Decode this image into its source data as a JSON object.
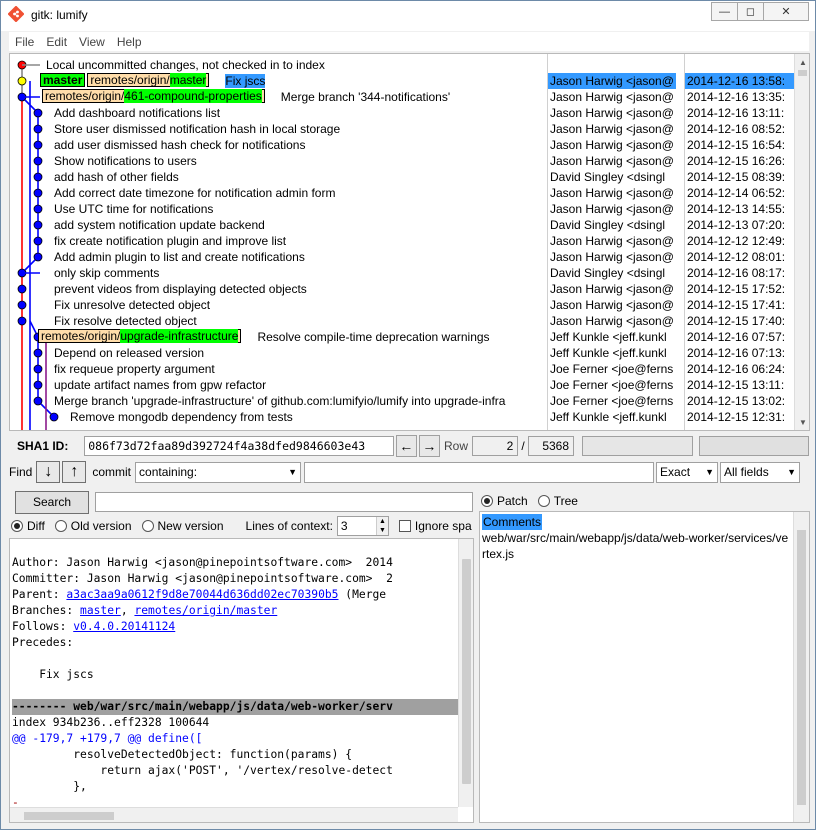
{
  "window": {
    "title": "gitk: lumify",
    "min": "—",
    "max": "◻",
    "close": "✕"
  },
  "menu": [
    "File",
    "Edit",
    "View",
    "Help"
  ],
  "history": {
    "rows": [
      {
        "subject": "Local uncommitted changes, not checked in to index",
        "refs": [],
        "author": "",
        "date": "",
        "dot": "red"
      },
      {
        "subject": "Fix jscs",
        "refs": [
          {
            "kind": "head",
            "text": "master"
          },
          {
            "kind": "remote",
            "prefix": "remotes/origin/",
            "branch": "master"
          }
        ],
        "author": "Jason Harwig <jason@",
        "date": "2014-12-16 13:58:",
        "dot": "yellow",
        "selected": true
      },
      {
        "subject": "Merge branch '344-notifications'",
        "refs": [
          {
            "kind": "remote",
            "prefix": "remotes/origin/",
            "branch": "461-compound-properties"
          }
        ],
        "author": "Jason Harwig <jason@",
        "date": "2014-12-16 13:35:",
        "dot": "blue"
      },
      {
        "subject": "Add dashboard notifications list",
        "refs": [],
        "author": "Jason Harwig <jason@",
        "date": "2014-12-16 13:11:",
        "dot": "blue"
      },
      {
        "subject": "Store user dismissed notification hash in local storage",
        "refs": [],
        "author": "Jason Harwig <jason@",
        "date": "2014-12-16 08:52:",
        "dot": "blue"
      },
      {
        "subject": "add user dismissed hash check for notifications",
        "refs": [],
        "author": "Jason Harwig <jason@",
        "date": "2014-12-15 16:54:",
        "dot": "blue"
      },
      {
        "subject": "Show notifications to users",
        "refs": [],
        "author": "Jason Harwig <jason@",
        "date": "2014-12-15 16:26:",
        "dot": "blue"
      },
      {
        "subject": "add hash of other fields",
        "refs": [],
        "author": "David Singley <dsingl",
        "date": "2014-12-15 08:39:",
        "dot": "blue"
      },
      {
        "subject": "Add correct date timezone for notification admin form",
        "refs": [],
        "author": "Jason Harwig <jason@",
        "date": "2014-12-14 06:52:",
        "dot": "blue"
      },
      {
        "subject": "Use UTC time for notifications",
        "refs": [],
        "author": "Jason Harwig <jason@",
        "date": "2014-12-13 14:55:",
        "dot": "blue"
      },
      {
        "subject": "add system notification update backend",
        "refs": [],
        "author": "David Singley <dsingl",
        "date": "2014-12-13 07:20:",
        "dot": "blue"
      },
      {
        "subject": "fix create notification plugin and improve list",
        "refs": [],
        "author": "Jason Harwig <jason@",
        "date": "2014-12-12 12:49:",
        "dot": "blue"
      },
      {
        "subject": "Add admin plugin to list and create notifications",
        "refs": [],
        "author": "Jason Harwig <jason@",
        "date": "2014-12-12 08:01:",
        "dot": "blue"
      },
      {
        "subject": "only skip comments",
        "refs": [],
        "author": "David Singley <dsingl",
        "date": "2014-12-16 08:17:",
        "dot": "blue"
      },
      {
        "subject": "prevent videos from displaying detected objects",
        "refs": [],
        "author": "Jason Harwig <jason@",
        "date": "2014-12-15 17:52:",
        "dot": "blue"
      },
      {
        "subject": "Fix unresolve detected object",
        "refs": [],
        "author": "Jason Harwig <jason@",
        "date": "2014-12-15 17:41:",
        "dot": "blue"
      },
      {
        "subject": "Fix resolve detected object",
        "refs": [],
        "author": "Jason Harwig <jason@",
        "date": "2014-12-15 17:40:",
        "dot": "blue"
      },
      {
        "subject": "Resolve compile-time deprecation warnings",
        "refs": [
          {
            "kind": "remote",
            "prefix": "remotes/origin/",
            "branch": "upgrade-infrastructure"
          }
        ],
        "author": "Jeff Kunkle <jeff.kunkl",
        "date": "2014-12-16 07:57:",
        "dot": "blue"
      },
      {
        "subject": "Depend on released version",
        "refs": [],
        "author": "Jeff Kunkle <jeff.kunkl",
        "date": "2014-12-16 07:13:",
        "dot": "blue"
      },
      {
        "subject": "fix requeue property argument",
        "refs": [],
        "author": "Joe Ferner <joe@ferns",
        "date": "2014-12-16 06:24:",
        "dot": "blue"
      },
      {
        "subject": "update artifact names from gpw refactor",
        "refs": [],
        "author": "Joe Ferner <joe@ferns",
        "date": "2014-12-15 13:11:",
        "dot": "blue"
      },
      {
        "subject": "Merge branch 'upgrade-infrastructure' of github.com:lumifyio/lumify into upgrade-infra",
        "refs": [],
        "author": "Joe Ferner <joe@ferns",
        "date": "2014-12-15 13:02:",
        "dot": "blue"
      },
      {
        "subject": "Remove mongodb dependency from tests",
        "refs": [],
        "author": "Jeff Kunkle <jeff.kunkl",
        "date": "2014-12-15 12:31:",
        "dot": "blue"
      }
    ]
  },
  "sha": {
    "label": "SHA1 ID:",
    "value": "086f73d72faa89d392724f4a38dfed9846603e43",
    "row_label": "Row",
    "row_current": "2",
    "row_sep": "/",
    "row_total": "5368"
  },
  "find": {
    "label": "Find",
    "commit_label": "commit",
    "containing": "containing:",
    "exact": "Exact",
    "fields": "All fields"
  },
  "search": {
    "button": "Search"
  },
  "diff_options": {
    "diff": "Diff",
    "old_version": "Old version",
    "new_version": "New version",
    "lines_of_context_label": "Lines of context:",
    "lines_of_context": "3",
    "ignore_space": "Ignore spa"
  },
  "diff": {
    "author_line": "Author: Jason Harwig <jason@pinepointsoftware.com>  2014",
    "committer_line": "Committer: Jason Harwig <jason@pinepointsoftware.com>  2",
    "parent_label": "Parent: ",
    "parent_hash": "a3ac3aa9a0612f9d8e70044d636dd02ec70390b5",
    "parent_rest": " (Merge",
    "branches_label": "Branches: ",
    "branch1": "master",
    "branch_sep": ", ",
    "branch2": "remotes/origin/master",
    "follows_label": "Follows: ",
    "follows_tag": "v0.4.0.20141124",
    "precedes_label": "Precedes:",
    "message": "    Fix jscs",
    "file_header": "-------- web/war/src/main/webapp/js/data/web-worker/serv",
    "index_line": "index 934b236..eff2328 100644",
    "hunk_line": "@@ -179,7 +179,7 @@ define([",
    "code1": "         resolveDetectedObject: function(params) {",
    "code2": "             return ajax('POST', '/vertex/resolve-detect",
    "code3": "         },",
    "minus_mark": "-",
    "plus_mark": "+"
  },
  "patch_tree": {
    "patch": "Patch",
    "tree": "Tree"
  },
  "files": {
    "comments": "Comments",
    "file1": "web/war/src/main/webapp/js/data/web-worker/services/vertex.js"
  },
  "colors": {
    "selection": "#3399ff",
    "head_ref": "#00ff00",
    "remote_ref": "#ffddaa",
    "graph_blue": "#0000ff",
    "graph_red": "#ff0000"
  }
}
